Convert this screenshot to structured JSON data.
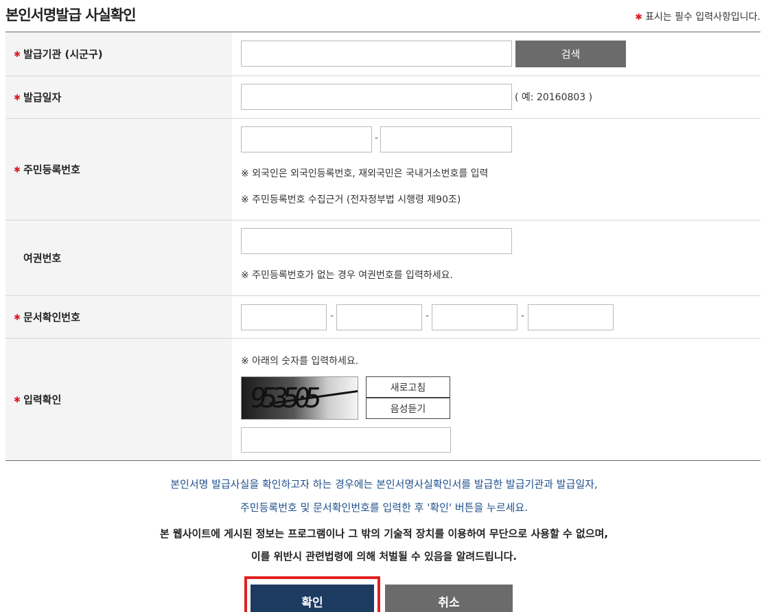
{
  "header": {
    "title": "본인서명발급 사실확인",
    "required_note": "표시는 필수 입력사항입니다.",
    "required_mark": "✱"
  },
  "form": {
    "issuer": {
      "label": "발급기관 (시군구)",
      "value": "",
      "search_label": "검색"
    },
    "issue_date": {
      "label": "발급일자",
      "value": "",
      "example": "( 예: 20160803 )"
    },
    "resident_no": {
      "label": "주민등록번호",
      "part1": "",
      "part2": "",
      "hint1": "※ 외국인은 외국인등록번호, 재외국민은 국내거소번호를 입력",
      "hint2": "※ 주민등록번호 수집근거 (전자정부법 시행령 제90조)"
    },
    "passport_no": {
      "label": "여권번호",
      "value": "",
      "hint": "※ 주민등록번호가 없는 경우 여권번호를 입력하세요."
    },
    "doc_no": {
      "label": "문서확인번호",
      "parts": [
        "",
        "",
        "",
        ""
      ]
    },
    "captcha": {
      "label": "입력확인",
      "hint": "※ 아래의 숫자를 입력하세요.",
      "captcha_text": "953505",
      "refresh_label": "새로고침",
      "audio_label": "음성듣기",
      "value": ""
    }
  },
  "notice": {
    "line1": "본인서명 발급사실을 확인하고자 하는 경우에는 본인서명사실확인서를 발급한 발급기관과 발급일자,",
    "line2": "주민등록번호 및 문서확인번호를 입력한 후 '확인' 버튼을 누르세요.",
    "line3": "본 웹사이트에 게시된 정보는 프로그램이나 그 밖의 기술적 장치를 이용하여 무단으로 사용할 수 없으며,",
    "line4": "이를 위반시 관련법령에 의해 처벌될 수 있음을 알려드립니다."
  },
  "actions": {
    "confirm_label": "확인",
    "cancel_label": "취소"
  },
  "colors": {
    "required": "#d81f26",
    "primary": "#1d3a61",
    "secondary": "#6b6b6b",
    "highlight": "#e02020",
    "notice_blue": "#1e4f8c"
  }
}
